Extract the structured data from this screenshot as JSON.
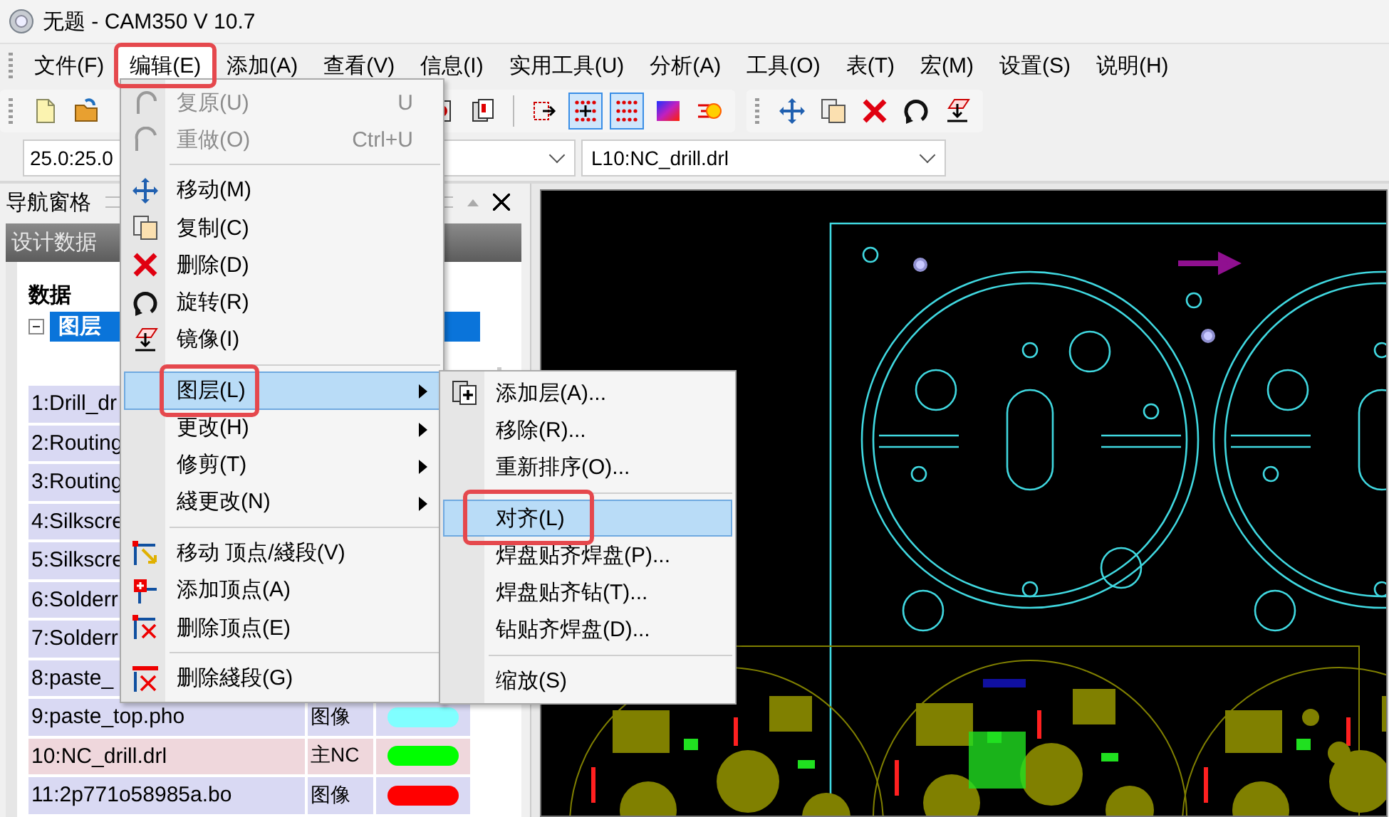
{
  "window": {
    "title": "无题 - CAM350 V 10.7"
  },
  "menu_bar": [
    {
      "label": "文件(F)",
      "selected": false,
      "callout": false
    },
    {
      "label": "编辑(E)",
      "selected": true,
      "callout": true
    },
    {
      "label": "添加(A)",
      "selected": false,
      "callout": false
    },
    {
      "label": "查看(V)",
      "selected": false,
      "callout": false
    },
    {
      "label": "信息(I)",
      "selected": false,
      "callout": false
    },
    {
      "label": "实用工具(U)",
      "selected": false,
      "callout": false
    },
    {
      "label": "分析(A)",
      "selected": false,
      "callout": false
    },
    {
      "label": "工具(O)",
      "selected": false,
      "callout": false
    },
    {
      "label": "表(T)",
      "selected": false,
      "callout": false
    },
    {
      "label": "宏(M)",
      "selected": false,
      "callout": false
    },
    {
      "label": "设置(S)",
      "selected": false,
      "callout": false
    },
    {
      "label": "说明(H)",
      "selected": false,
      "callout": false
    }
  ],
  "toolbars": [
    {
      "buttons": [
        {
          "kind": "newfile",
          "selected": false
        },
        {
          "kind": "open",
          "selected": false
        }
      ]
    },
    {
      "buttons": [
        {
          "kind": "redsheet",
          "selected": false
        },
        {
          "kind": "sheets",
          "selected": false
        },
        {
          "kind": "divider"
        },
        {
          "kind": "frame",
          "selected": false
        },
        {
          "kind": "griddot",
          "selected": true
        },
        {
          "kind": "grid",
          "selected": true
        },
        {
          "kind": "gradient",
          "selected": false
        },
        {
          "kind": "flare",
          "selected": false
        }
      ]
    },
    {
      "buttons": [
        {
          "kind": "move",
          "selected": false
        },
        {
          "kind": "copy",
          "selected": false
        },
        {
          "kind": "delete",
          "selected": false
        },
        {
          "kind": "rotate",
          "selected": false
        },
        {
          "kind": "mirror",
          "selected": false
        }
      ]
    }
  ],
  "coordinate_bar": {
    "coordinates": "25.0:25.0",
    "active_layer": "L10:NC_drill.drl"
  },
  "nav_pane": {
    "title": "导航窗格",
    "section": "设计数据",
    "root": "数据",
    "tree": [
      {
        "label": "图层",
        "expanded": true,
        "selected": true
      }
    ],
    "layers": [
      {
        "name": "1:Drill_dr",
        "selected": false
      },
      {
        "name": "2:Routing",
        "selected": false
      },
      {
        "name": "3:Routing",
        "selected": false
      },
      {
        "name": "4:Silkscre",
        "selected": false
      },
      {
        "name": "5:Silkscre",
        "selected": false
      },
      {
        "name": "6:Solderr",
        "selected": false
      },
      {
        "name": "7:Solderr",
        "selected": false
      },
      {
        "name": "8:paste_",
        "selected": false
      },
      {
        "name": "9:paste_top.pho",
        "type": "图像",
        "color": "#80ffff",
        "selected": false
      },
      {
        "name": "10:NC_drill.drl",
        "type": "主NC",
        "color": "#00ff00",
        "selected": true
      },
      {
        "name": "11:2p771o58985a.bo",
        "type": "图像",
        "color": "#ff0000",
        "selected": false
      }
    ]
  },
  "edit_menu": {
    "items": [
      {
        "kind": "item",
        "label": "复原(U)",
        "shortcut": "U",
        "disabled": true,
        "selected": false,
        "submenu": false,
        "callout": false
      },
      {
        "kind": "item",
        "label": "重做(O)",
        "shortcut": "Ctrl+U",
        "disabled": true,
        "selected": false,
        "submenu": false,
        "callout": false
      },
      {
        "kind": "separator"
      },
      {
        "kind": "item",
        "label": "移动(M)",
        "disabled": false,
        "selected": false,
        "submenu": false,
        "callout": false
      },
      {
        "kind": "item",
        "label": "复制(C)",
        "disabled": false,
        "selected": false,
        "submenu": false,
        "callout": false
      },
      {
        "kind": "item",
        "label": "删除(D)",
        "disabled": false,
        "selected": false,
        "submenu": false,
        "callout": false
      },
      {
        "kind": "item",
        "label": "旋转(R)",
        "disabled": false,
        "selected": false,
        "submenu": false,
        "callout": false
      },
      {
        "kind": "item",
        "label": "镜像(I)",
        "disabled": false,
        "selected": false,
        "submenu": false,
        "callout": false
      },
      {
        "kind": "separator"
      },
      {
        "kind": "item",
        "label": "图层(L)",
        "disabled": false,
        "selected": true,
        "submenu": true,
        "callout": true
      },
      {
        "kind": "item",
        "label": "更改(H)",
        "disabled": false,
        "selected": false,
        "submenu": true,
        "callout": false
      },
      {
        "kind": "item",
        "label": "修剪(T)",
        "disabled": false,
        "selected": false,
        "submenu": true,
        "callout": false
      },
      {
        "kind": "item",
        "label": "綫更改(N)",
        "disabled": false,
        "selected": false,
        "submenu": true,
        "callout": false
      },
      {
        "kind": "separator"
      },
      {
        "kind": "item",
        "label": "移动 顶点/綫段(V)",
        "disabled": false,
        "selected": false,
        "submenu": false,
        "callout": false
      },
      {
        "kind": "item",
        "label": "添加顶点(A)",
        "disabled": false,
        "selected": false,
        "submenu": false,
        "callout": false
      },
      {
        "kind": "item",
        "label": "删除顶点(E)",
        "disabled": false,
        "selected": false,
        "submenu": false,
        "callout": false
      },
      {
        "kind": "separator"
      },
      {
        "kind": "item",
        "label": "删除綫段(G)",
        "disabled": false,
        "selected": false,
        "submenu": false,
        "callout": false
      }
    ]
  },
  "layer_submenu": {
    "items": [
      {
        "kind": "item",
        "label": "添加层(A)...",
        "selected": false,
        "callout": false
      },
      {
        "kind": "item",
        "label": "移除(R)...",
        "selected": false,
        "callout": false
      },
      {
        "kind": "item",
        "label": "重新排序(O)...",
        "selected": false,
        "callout": false
      },
      {
        "kind": "separator"
      },
      {
        "kind": "item",
        "label": "对齐(L)",
        "selected": true,
        "callout": true
      },
      {
        "kind": "item",
        "label": "焊盘贴齐焊盘(P)...",
        "selected": false,
        "callout": false
      },
      {
        "kind": "item",
        "label": "焊盘贴齐钻(T)...",
        "selected": false,
        "callout": false
      },
      {
        "kind": "item",
        "label": "钻贴齐焊盘(D)...",
        "selected": false,
        "callout": false
      },
      {
        "kind": "separator"
      },
      {
        "kind": "item",
        "label": "缩放(S)",
        "selected": false,
        "callout": false
      }
    ]
  }
}
